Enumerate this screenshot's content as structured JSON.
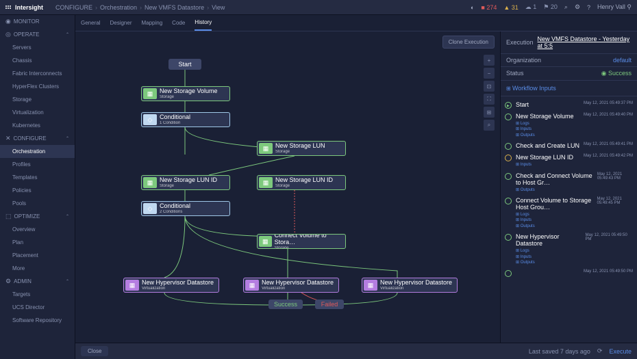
{
  "brand": "Intersight",
  "breadcrumbs": [
    "CONFIGURE",
    "Orchestration",
    "New VMFS Datastore",
    "View"
  ],
  "top_badges": {
    "red": "274",
    "yellow": "31",
    "n1": "1",
    "n2": "20"
  },
  "user": "Henry Vall",
  "sidebar": [
    {
      "type": "hdr",
      "label": "MONITOR",
      "icon": "◉"
    },
    {
      "type": "hdr",
      "label": "OPERATE",
      "icon": "◎",
      "exp": true
    },
    {
      "type": "item",
      "label": "Servers"
    },
    {
      "type": "item",
      "label": "Chassis"
    },
    {
      "type": "item",
      "label": "Fabric Interconnects"
    },
    {
      "type": "item",
      "label": "HyperFlex Clusters"
    },
    {
      "type": "item",
      "label": "Storage"
    },
    {
      "type": "item",
      "label": "Virtualization"
    },
    {
      "type": "item",
      "label": "Kubernetes"
    },
    {
      "type": "hdr",
      "label": "CONFIGURE",
      "icon": "✕",
      "exp": true
    },
    {
      "type": "item",
      "label": "Orchestration",
      "active": true
    },
    {
      "type": "item",
      "label": "Profiles"
    },
    {
      "type": "item",
      "label": "Templates"
    },
    {
      "type": "item",
      "label": "Policies"
    },
    {
      "type": "item",
      "label": "Pools"
    },
    {
      "type": "hdr",
      "label": "OPTIMIZE",
      "icon": "⬚",
      "exp": true
    },
    {
      "type": "item",
      "label": "Overview"
    },
    {
      "type": "item",
      "label": "Plan"
    },
    {
      "type": "item",
      "label": "Placement"
    },
    {
      "type": "item",
      "label": "More"
    },
    {
      "type": "hdr",
      "label": "ADMIN",
      "icon": "⚙",
      "exp": true
    },
    {
      "type": "item",
      "label": "Targets"
    },
    {
      "type": "item",
      "label": "UCS Director"
    },
    {
      "type": "item",
      "label": "Software Repository"
    }
  ],
  "tabs": [
    "General",
    "Designer",
    "Mapping",
    "Code",
    "History"
  ],
  "active_tab": "History",
  "canvas": {
    "clone": "Clone Execution",
    "tools": [
      "+",
      "−",
      "⊡",
      "⛶",
      "⊞",
      "⌕"
    ],
    "nodes": {
      "start": "Start",
      "nsv": {
        "t": "New Storage Volume",
        "s": "Storage"
      },
      "cond1": {
        "t": "Conditional",
        "s": "1 Condition"
      },
      "nsl": {
        "t": "New Storage LUN",
        "s": "Storage"
      },
      "nslid1": {
        "t": "New Storage LUN ID",
        "s": "Storage"
      },
      "nslid2": {
        "t": "New Storage LUN ID",
        "s": "Storage"
      },
      "cond2": {
        "t": "Conditional",
        "s": "2 Conditions"
      },
      "cvs": {
        "t": "Connect Volume to Stora…",
        "s": "Storage"
      },
      "hd1": {
        "t": "New Hypervisor Datastore",
        "s": "Virtualization"
      },
      "hd2": {
        "t": "New Hypervisor Datastore",
        "s": "Virtualization"
      },
      "hd3": {
        "t": "New Hypervisor Datastore",
        "s": "Virtualization"
      },
      "success": "Success",
      "failed": "Failed"
    }
  },
  "exec": {
    "title": "Execution",
    "link": "New VMFS Datastore - Yesterday at 5:5",
    "org_l": "Organization",
    "org_v": "default",
    "status_l": "Status",
    "status_v": "Success",
    "wf_inputs": "Workflow Inputs",
    "steps": [
      {
        "name": "Start",
        "ts": "May 12, 2021 05:49:37 PM",
        "dot": "play"
      },
      {
        "name": "New Storage Volume",
        "ts": "May 12, 2021 05:49:40 PM",
        "links": [
          "Logs",
          "Inputs",
          "Outputs"
        ]
      },
      {
        "name": "Check and Create LUN",
        "ts": "May 12, 2021 05:49:41 PM"
      },
      {
        "name": "New Storage LUN ID",
        "ts": "May 12, 2021 05:49:42 PM",
        "dot": "yellow",
        "links": [
          "Inputs"
        ]
      },
      {
        "name": "Check and Connect Volume to Host Gr…",
        "ts": "May 12, 2021 05:49:43 PM",
        "links": [
          "Outputs"
        ]
      },
      {
        "name": "Connect Volume to Storage Host Grou…",
        "ts": "May 12, 2021 05:49:45 PM",
        "links": [
          "Logs",
          "Inputs",
          "Outputs"
        ]
      },
      {
        "name": "New Hypervisor Datastore",
        "ts": "May 12, 2021 05:49:50 PM",
        "links": [
          "Logs",
          "Inputs",
          "Outputs"
        ]
      },
      {
        "name": "",
        "ts": "May 12, 2021 05:49:50 PM"
      }
    ]
  },
  "footer": {
    "close": "Close",
    "saved": "Last saved 7 days ago",
    "exec": "Execute"
  }
}
